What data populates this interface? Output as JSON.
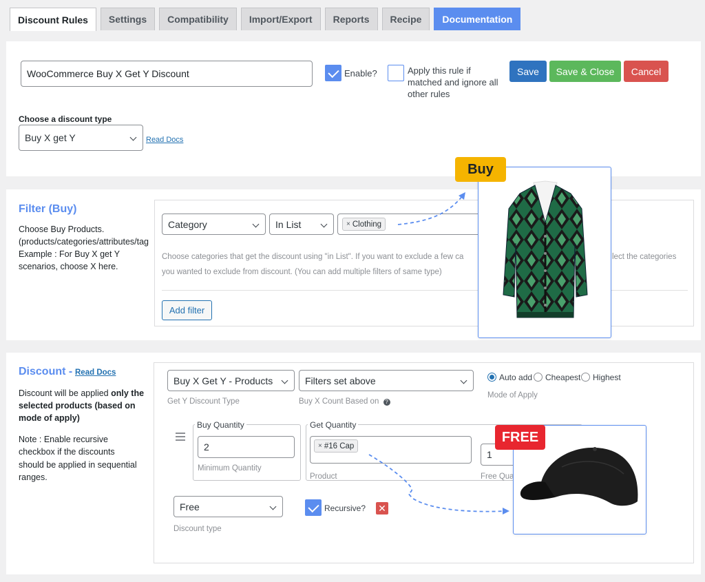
{
  "tabs": [
    {
      "label": "Discount Rules"
    },
    {
      "label": "Settings"
    },
    {
      "label": "Compatibility"
    },
    {
      "label": "Import/Export"
    },
    {
      "label": "Reports"
    },
    {
      "label": "Recipe"
    },
    {
      "label": "Documentation"
    }
  ],
  "rule": {
    "name": "WooCommerce Buy X Get Y Discount",
    "enable_label": "Enable?",
    "enable_checked": true,
    "exclusive_label_1": "Apply this rule if",
    "exclusive_label_2": "matched and ignore all",
    "exclusive_label_3": "other rules",
    "exclusive_checked": false,
    "save": "Save",
    "save_close": "Save & Close",
    "cancel": "Cancel",
    "discount_type_heading": "Choose a discount type",
    "discount_type_value": "Buy X get Y",
    "read_docs": "Read Docs"
  },
  "filter": {
    "title": "Filter (Buy)",
    "desc_1": "Choose Buy Products.",
    "desc_2": "(products/categories/attributes/tag",
    "desc_3": "Example : For Buy X get Y",
    "desc_4": "scenarios, choose X here.",
    "type_value": "Category",
    "method_value": "In List",
    "chip": "Clothing",
    "hint_1": "Choose categories that get the discount using \"in List\". If you want to exclude a few ca",
    "hint_1b": "lect the categories",
    "hint_2": "you wanted to exclude from discount. (You can add multiple filters of same type)",
    "add_filter": "Add filter",
    "badge": "Buy"
  },
  "discount": {
    "title": "Discount -",
    "read_docs": "Read Docs",
    "desc_a1": "Discount will be applied",
    "desc_a2": "only the",
    "desc_a3": "selected products (based on",
    "desc_a4": "mode of apply)",
    "note_1": "Note : Enable recursive",
    "note_2": "checkbox if the discounts",
    "note_3": "should be applied in sequential",
    "note_4": "ranges.",
    "get_type_value": "Buy X Get Y - Products",
    "get_type_label": "Get Y Discount Type",
    "count_value": "Filters set above",
    "count_label": "Buy X Count Based on",
    "help_icon": "?",
    "mode_auto": "Auto add",
    "mode_cheapest": "Cheapest",
    "mode_highest": "Highest",
    "mode_label": "Mode of Apply",
    "buy_qty_legend": "Buy Quantity",
    "buy_qty_value": "2",
    "buy_qty_sub": "Minimum Quantity",
    "get_qty_legend": "Get Quantity",
    "product_chip": "#16 Cap",
    "product_sub": "Product",
    "free_qty_value": "1",
    "free_qty_sub": "Free Qua",
    "type_value": "Free",
    "type_sub": "Discount type",
    "recursive_label": "Recursive?",
    "recursive_checked": true,
    "badge": "FREE"
  },
  "colors": {
    "accent": "#5b8def",
    "save": "#2f73bf",
    "save_close": "#5cb85c",
    "cancel": "#d9534f",
    "buy_badge": "#f5b400",
    "free_badge": "#e8262f"
  }
}
